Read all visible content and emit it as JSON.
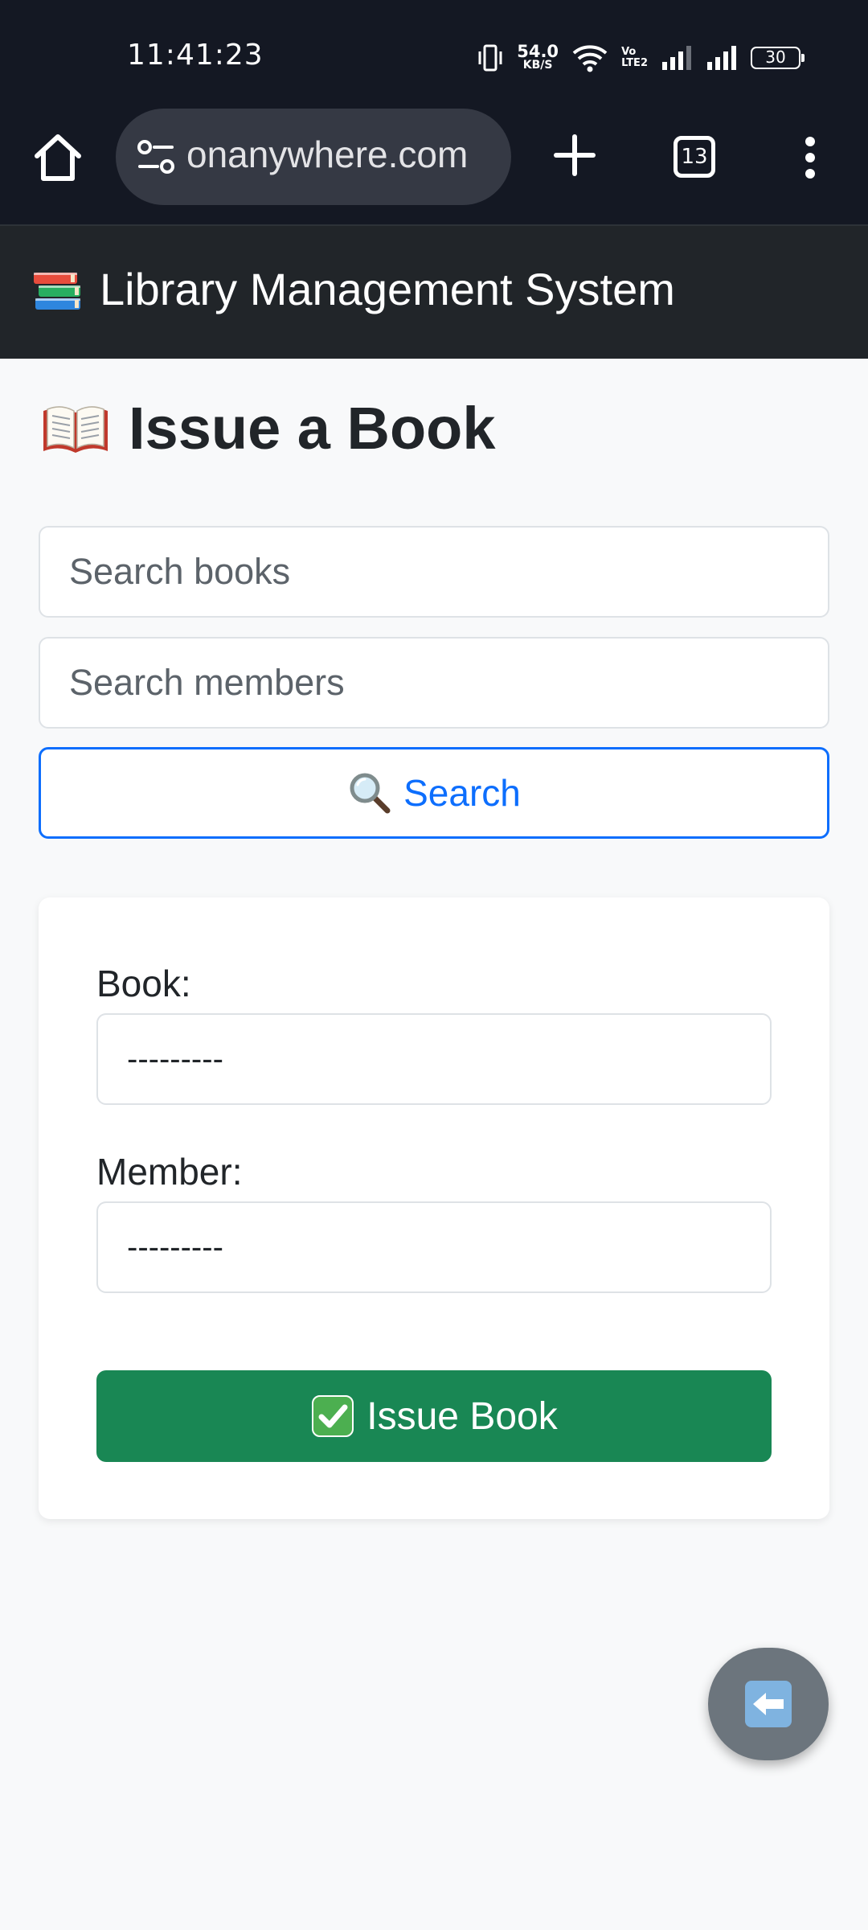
{
  "status_bar": {
    "time": "11:41:23",
    "net_speed_value": "54.0",
    "net_speed_unit": "KB/S",
    "volte_line1": "Vo",
    "volte_line2": "LTE2",
    "battery": "30"
  },
  "browser": {
    "url": "onanywhere.com",
    "tab_count": "13"
  },
  "navbar": {
    "brand": "Library Management System",
    "brand_icon": "books-icon"
  },
  "page": {
    "title": "Issue a Book",
    "title_icon": "open-book-icon"
  },
  "search": {
    "books_placeholder": "Search books",
    "members_placeholder": "Search members",
    "button_label": "Search",
    "button_icon": "magnifier-icon"
  },
  "form": {
    "book_label": "Book:",
    "book_selected": "---------",
    "member_label": "Member:",
    "member_selected": "---------",
    "submit_label": "Issue Book",
    "submit_icon": "check-mark-button-icon"
  },
  "fab": {
    "icon": "back-arrow-icon"
  },
  "colors": {
    "primary": "#0d6efd",
    "success": "#198754",
    "secondary": "#6c757d",
    "navbar_bg": "#212529",
    "page_bg": "#f8f9fa"
  }
}
